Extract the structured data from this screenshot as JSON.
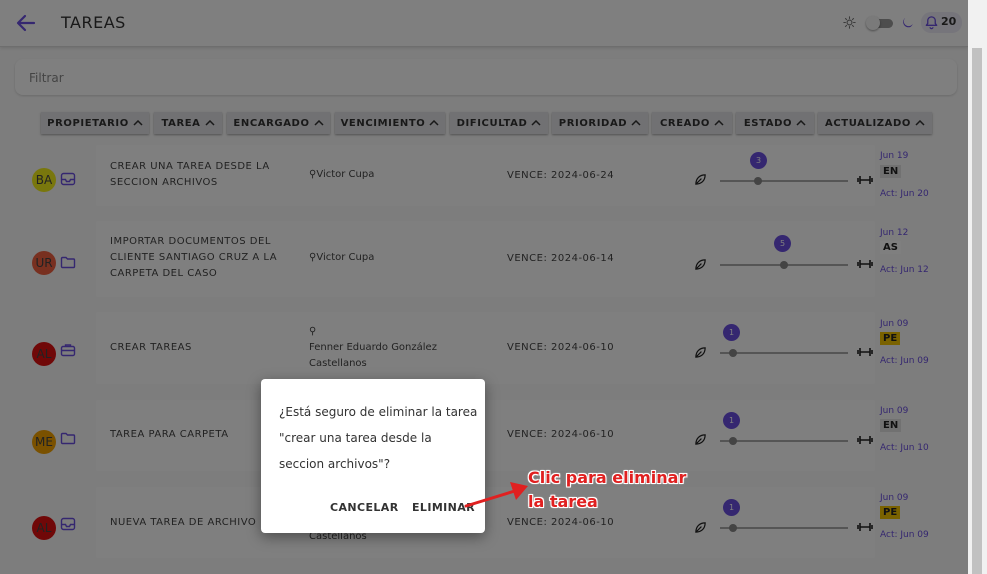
{
  "header": {
    "title": "TAREAS",
    "notifications": "20"
  },
  "filter": {
    "placeholder": "Filtrar"
  },
  "columns": [
    "PROPIETARIO",
    "TAREA",
    "ENCARGADO",
    "VENCIMIENTO",
    "DIFICULTAD",
    "PRIORIDAD",
    "CREADO",
    "ESTADO",
    "ACTUALIZADO"
  ],
  "tasks": [
    {
      "owner": "BA",
      "owner_color": "#f3ef1a",
      "icon": "inbox-icon",
      "title": "CREAR UNA TAREA DESDE LA SECCION ARCHIVOS",
      "assignee": "Victor Cupa",
      "due": "VENCE: 2024-06-24",
      "priority": "3",
      "priority_fraction": 0.3,
      "created": "Jun 19",
      "status": "EN",
      "status_color": "#e3e3e3",
      "updated": "Act: Jun 20"
    },
    {
      "owner": "UR",
      "owner_color": "#f06040",
      "icon": "folder-icon",
      "title": "IMPORTAR DOCUMENTOS DEL CLIENTE SANTIAGO CRUZ A LA CARPETA DEL CASO",
      "assignee": "Victor Cupa",
      "due": "VENCE: 2024-06-14",
      "priority": "5",
      "priority_fraction": 0.5,
      "created": "Jun 12",
      "status": "AS",
      "status_color": "#ffffff",
      "updated": "Act: Jun 12"
    },
    {
      "owner": "AL",
      "owner_color": "#e01010",
      "icon": "briefcase-icon",
      "title": "CREAR TAREAS",
      "assignee": "Fenner Eduardo González Castellanos",
      "due": "VENCE: 2024-06-10",
      "priority": "1",
      "priority_fraction": 0.1,
      "created": "Jun 09",
      "status": "PE",
      "status_color": "#f5c400",
      "updated": "Act: Jun 09"
    },
    {
      "owner": "ME",
      "owner_color": "#f5a200",
      "icon": "folder-icon",
      "title": "TAREA PARA CARPETA",
      "assignee": "",
      "due": "VENCE: 2024-06-10",
      "priority": "1",
      "priority_fraction": 0.1,
      "created": "Jun 09",
      "status": "EN",
      "status_color": "#e3e3e3",
      "updated": "Act: Jun 10"
    },
    {
      "owner": "AL",
      "owner_color": "#e01010",
      "icon": "inbox-icon",
      "title": "NUEVA TAREA DE ARCHIVO",
      "assignee": "Castellanos",
      "due": "VENCE: 2024-06-10",
      "priority": "1",
      "priority_fraction": 0.1,
      "created": "Jun 09",
      "status": "PE",
      "status_color": "#f5c400",
      "updated": "Act: Jun 09"
    }
  ],
  "dialog": {
    "message": "¿Está seguro de eliminar la tarea \"crear una tarea desde la seccion archivos\"?",
    "cancel": "CANCELAR",
    "confirm": "ELIMINAR"
  },
  "annotation": {
    "line1": "Clic para eliminar",
    "line2": "la tarea"
  },
  "colors": {
    "accent": "#6b4fe0",
    "annotation": "#e02020"
  }
}
